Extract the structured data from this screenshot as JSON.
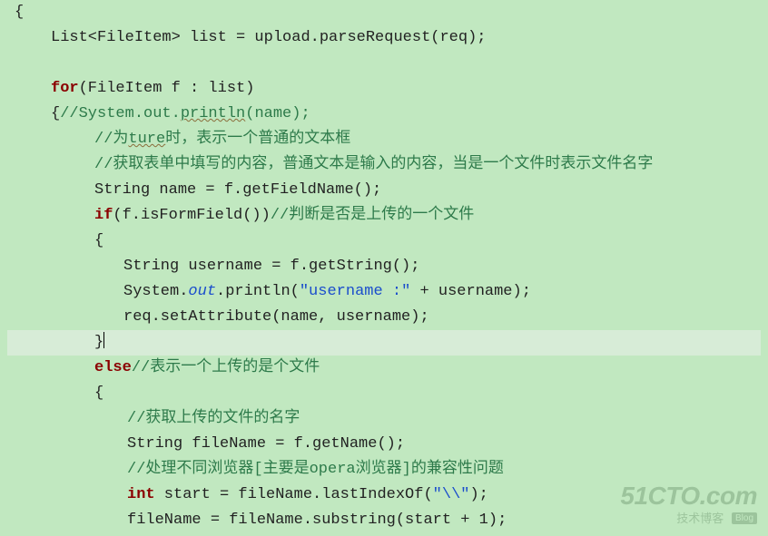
{
  "lines": [
    {
      "indent": 8,
      "hl": false,
      "segments": [
        {
          "cls": "plain",
          "txt": "{"
        }
      ]
    },
    {
      "indent": 48,
      "hl": false,
      "segments": [
        {
          "cls": "plain",
          "txt": "List<FileItem> list = upload.parseRequest(req);"
        }
      ]
    },
    {
      "indent": 0,
      "hl": false,
      "segments": []
    },
    {
      "indent": 48,
      "hl": false,
      "segments": [
        {
          "cls": "keyword",
          "txt": "for"
        },
        {
          "cls": "plain",
          "txt": "(FileItem f : list)"
        }
      ]
    },
    {
      "indent": 48,
      "hl": false,
      "segments": [
        {
          "cls": "plain",
          "txt": "{"
        },
        {
          "cls": "comment",
          "txt": "//System.out."
        },
        {
          "cls": "comment wavy",
          "txt": "println"
        },
        {
          "cls": "comment",
          "txt": "(name);"
        }
      ]
    },
    {
      "indent": 96,
      "hl": false,
      "segments": [
        {
          "cls": "comment",
          "txt": "//为"
        },
        {
          "cls": "comment wavy",
          "txt": "ture"
        },
        {
          "cls": "comment",
          "txt": "时，表示一个普通的文本框"
        }
      ]
    },
    {
      "indent": 96,
      "hl": false,
      "segments": [
        {
          "cls": "comment",
          "txt": "//获取表单中填写的内容，普通文本是输入的内容，当是一个文件时表示文件名字"
        }
      ]
    },
    {
      "indent": 96,
      "hl": false,
      "segments": [
        {
          "cls": "plain",
          "txt": "String name = f.getFieldName();"
        }
      ]
    },
    {
      "indent": 96,
      "hl": false,
      "segments": [
        {
          "cls": "keyword",
          "txt": "if"
        },
        {
          "cls": "plain",
          "txt": "(f.isFormField())"
        },
        {
          "cls": "comment",
          "txt": "//判断是否是上传的一个文件"
        }
      ]
    },
    {
      "indent": 96,
      "hl": false,
      "segments": [
        {
          "cls": "plain",
          "txt": "{"
        }
      ]
    },
    {
      "indent": 128,
      "hl": false,
      "segments": [
        {
          "cls": "plain",
          "txt": "String username = f.getString();"
        }
      ]
    },
    {
      "indent": 128,
      "hl": false,
      "segments": [
        {
          "cls": "plain",
          "txt": "System."
        },
        {
          "cls": "static-field",
          "txt": "out"
        },
        {
          "cls": "plain",
          "txt": ".println("
        },
        {
          "cls": "string",
          "txt": "\"username :\""
        },
        {
          "cls": "plain",
          "txt": " + username);"
        }
      ]
    },
    {
      "indent": 128,
      "hl": false,
      "segments": [
        {
          "cls": "plain",
          "txt": "req.setAttribute(name, username);"
        }
      ]
    },
    {
      "indent": 96,
      "hl": true,
      "segments": [
        {
          "cls": "plain",
          "txt": "}"
        },
        {
          "cls": "cursor",
          "txt": ""
        }
      ]
    },
    {
      "indent": 96,
      "hl": false,
      "segments": [
        {
          "cls": "keyword",
          "txt": "else"
        },
        {
          "cls": "comment",
          "txt": "//表示一个上传的是个文件"
        }
      ]
    },
    {
      "indent": 96,
      "hl": false,
      "segments": [
        {
          "cls": "plain",
          "txt": "{"
        }
      ]
    },
    {
      "indent": 132,
      "hl": false,
      "segments": [
        {
          "cls": "comment",
          "txt": "//获取上传的文件的名字"
        }
      ]
    },
    {
      "indent": 132,
      "hl": false,
      "segments": [
        {
          "cls": "plain",
          "txt": "String fileName = f.getName();"
        }
      ]
    },
    {
      "indent": 132,
      "hl": false,
      "segments": [
        {
          "cls": "comment",
          "txt": "//处理不同浏览器[主要是opera浏览器]的兼容性问题"
        }
      ]
    },
    {
      "indent": 132,
      "hl": false,
      "segments": [
        {
          "cls": "keyword",
          "txt": "int"
        },
        {
          "cls": "plain",
          "txt": " start = fileName.lastIndexOf("
        },
        {
          "cls": "string",
          "txt": "\"\\\\\""
        },
        {
          "cls": "plain",
          "txt": ");"
        }
      ]
    },
    {
      "indent": 132,
      "hl": false,
      "segments": [
        {
          "cls": "plain",
          "txt": "fileName = fileName.substring(start + 1);"
        }
      ]
    }
  ],
  "watermark": {
    "top": "51CTO.com",
    "sub": "技术博客",
    "tag": "Blog"
  }
}
